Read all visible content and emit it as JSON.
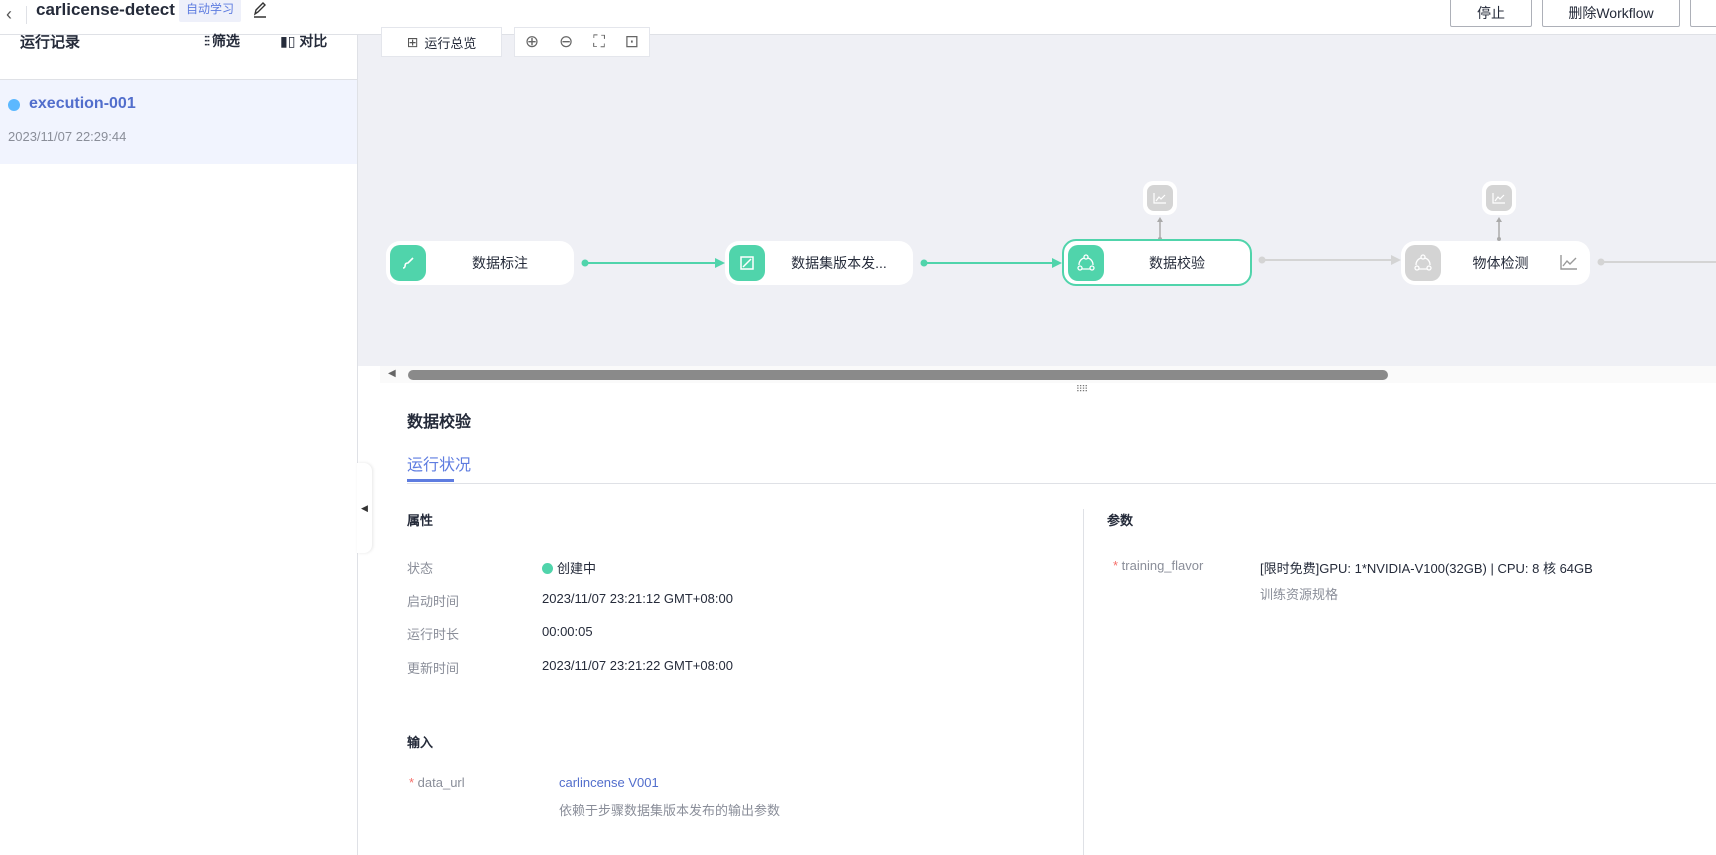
{
  "header": {
    "title": "carlicense-detect",
    "tag": "自动学习",
    "buttons": [
      "停止",
      "删除Workflow"
    ]
  },
  "sidebar": {
    "title": "运行记录",
    "filter": "筛选",
    "compare": "对比",
    "items": [
      {
        "name": "execution-001",
        "time": "2023/11/07 22:29:44",
        "status_color": "#5cb8ff"
      }
    ]
  },
  "canvas": {
    "overview": "运行总览",
    "nodes": [
      {
        "label": "数据标注",
        "state": "done"
      },
      {
        "label": "数据集版本发...",
        "state": "done"
      },
      {
        "label": "数据校验",
        "state": "running"
      },
      {
        "label": "物体检测",
        "state": "pending"
      }
    ]
  },
  "colors": {
    "accent": "#5e7ce0",
    "success": "#50d4ab",
    "pending": "#d4d4d4"
  },
  "detail": {
    "title": "数据校验",
    "tab": "运行状况",
    "props_title": "属性",
    "props": [
      {
        "label": "状态",
        "value": "创建中"
      },
      {
        "label": "启动时间",
        "value": "2023/11/07 23:21:12 GMT+08:00"
      },
      {
        "label": "运行时长",
        "value": "00:00:05"
      },
      {
        "label": "更新时间",
        "value": "2023/11/07 23:21:22 GMT+08:00"
      }
    ],
    "input_title": "输入",
    "input": {
      "name": "data_url",
      "value": "carlincense V001",
      "desc": "依赖于步骤数据集版本发布的输出参数"
    },
    "params_title": "参数",
    "param": {
      "name": "training_flavor",
      "value": "[限时免费]GPU: 1*NVIDIA-V100(32GB) | CPU: 8 核 64GB",
      "desc": "训练资源规格"
    }
  }
}
